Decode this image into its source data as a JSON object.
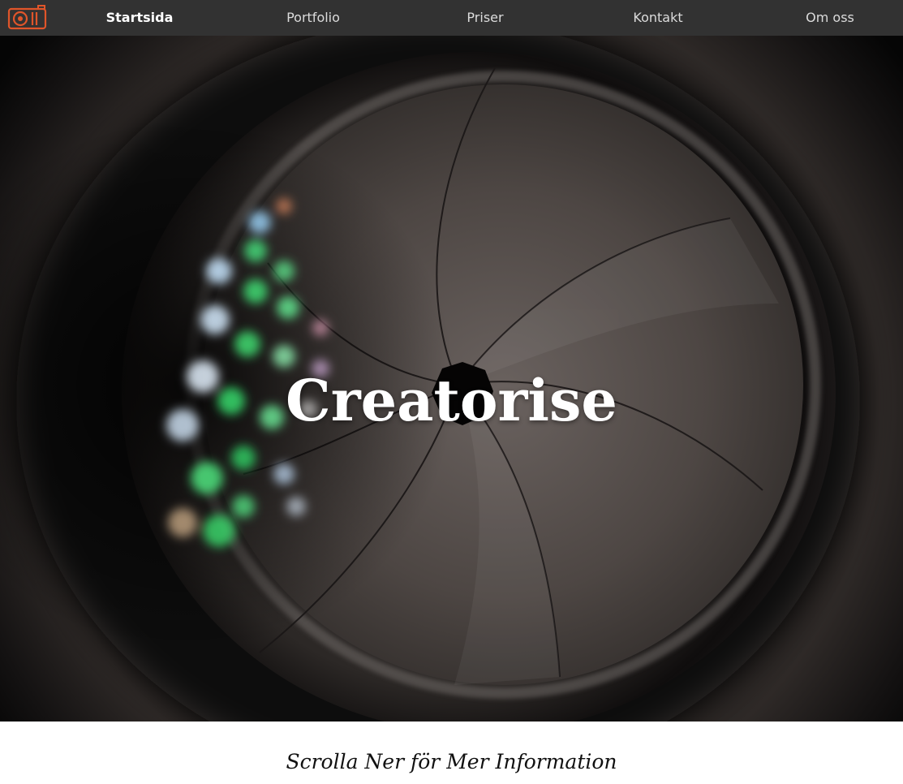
{
  "navbar": {
    "logo_icon": "camera-logo-icon",
    "logo_color": "#e0552a",
    "items": [
      {
        "label": "Startsida",
        "active": true
      },
      {
        "label": "Portfolio",
        "active": false
      },
      {
        "label": "Priser",
        "active": false
      },
      {
        "label": "Kontakt",
        "active": false
      },
      {
        "label": "Om oss",
        "active": false
      }
    ]
  },
  "hero": {
    "title": "Creatorise",
    "background": "camera-lens-aperture-photo"
  },
  "footer": {
    "scroll_hint": "Scrolla Ner för Mer Information"
  }
}
